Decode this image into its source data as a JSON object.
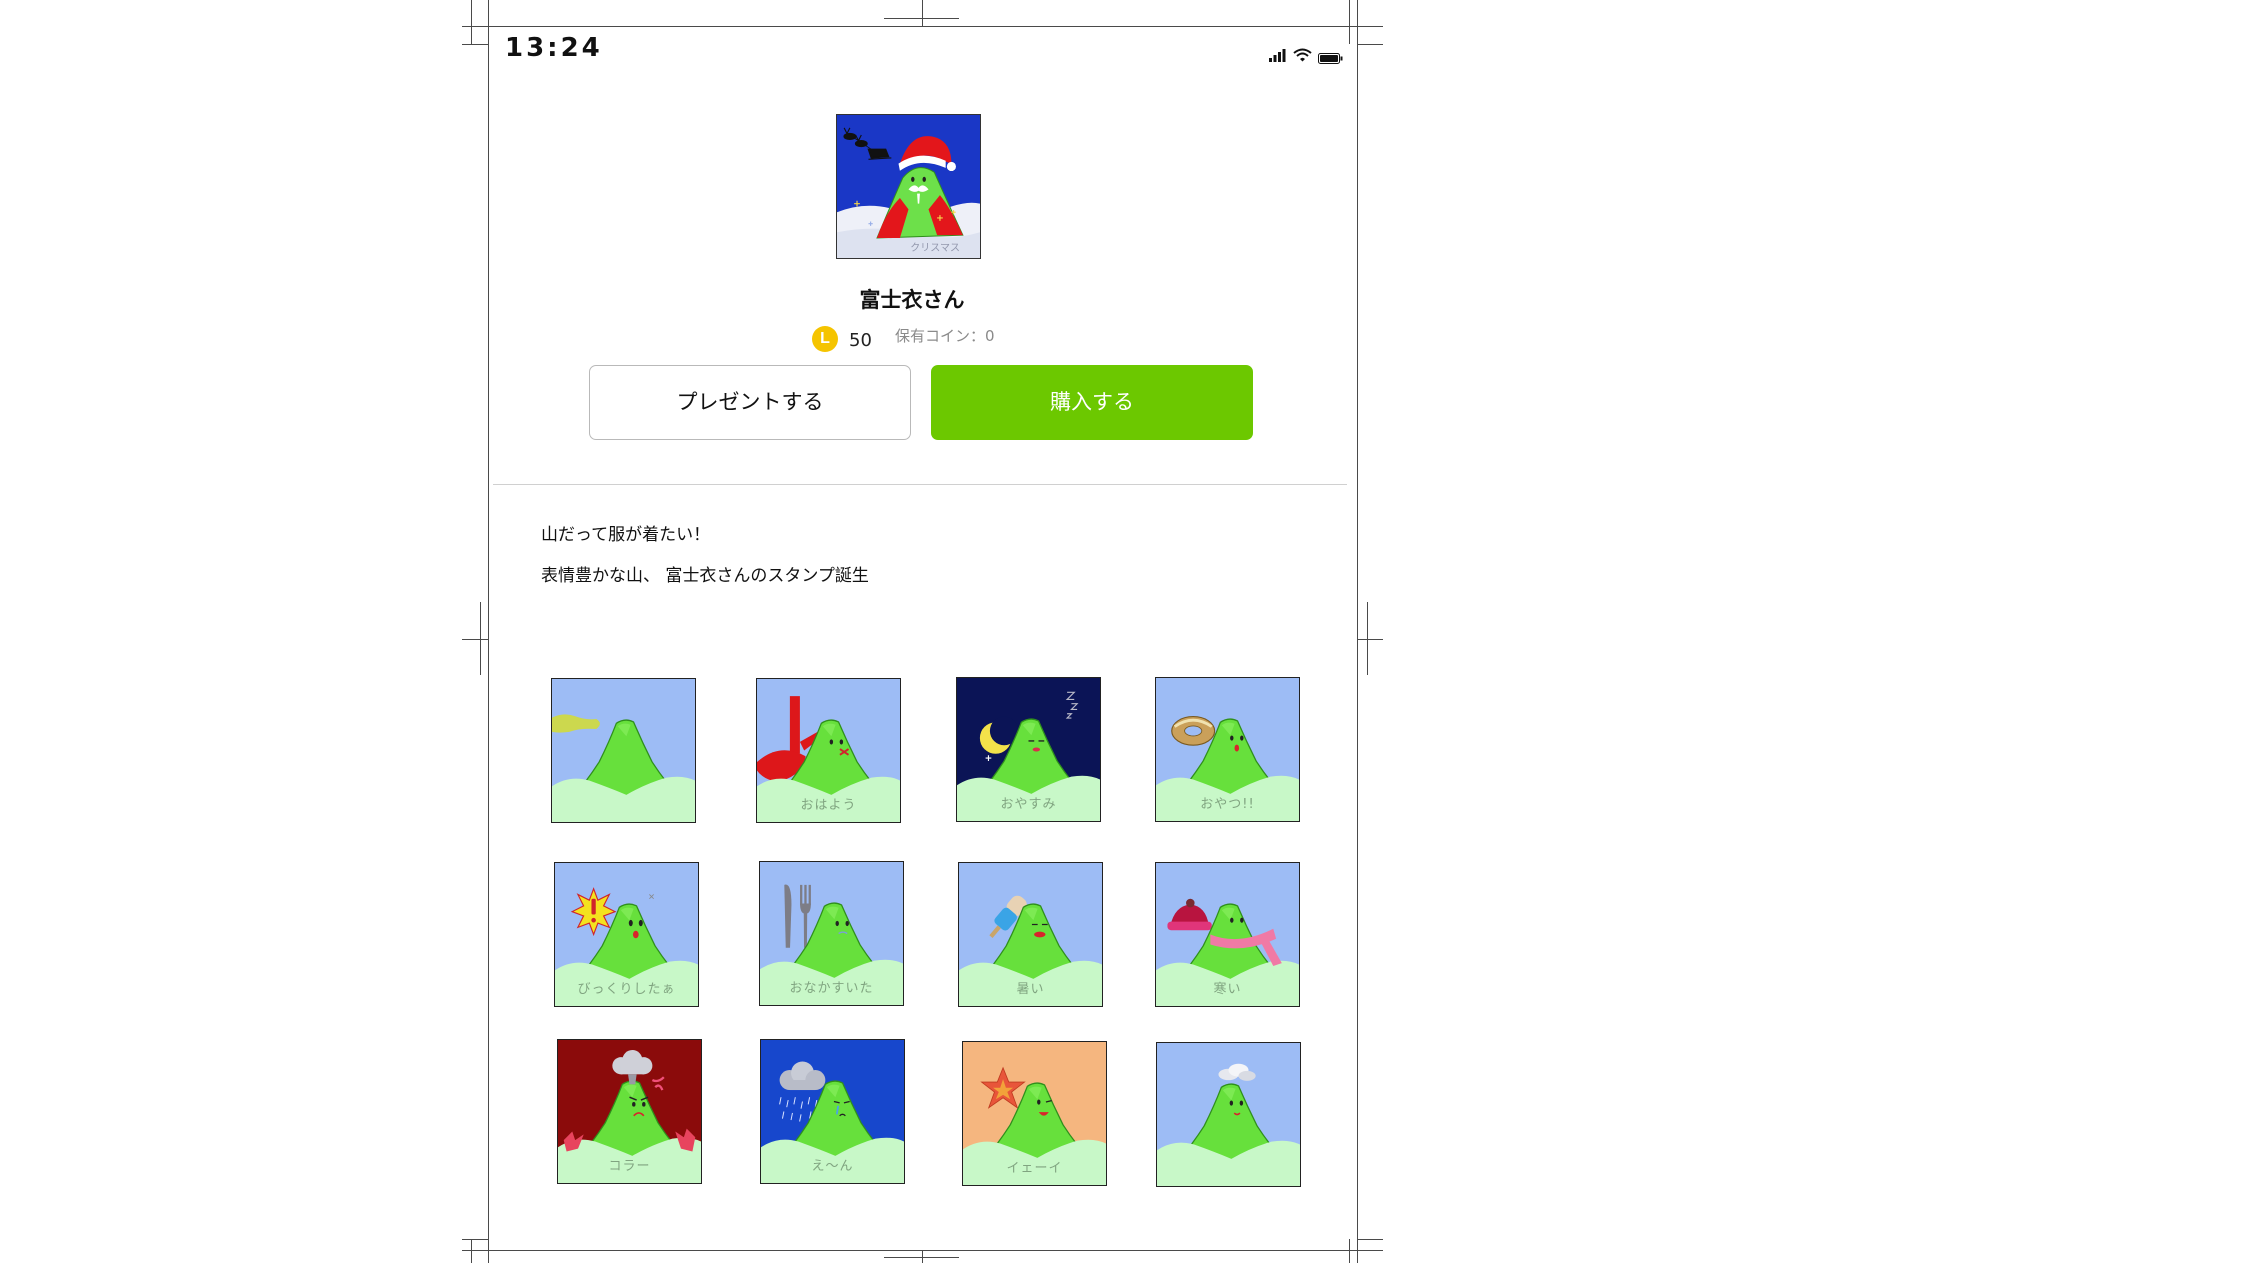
{
  "status_bar": {
    "time": "13:24",
    "icons": [
      "signal-icon",
      "wifi-icon",
      "battery-icon"
    ]
  },
  "product": {
    "image_caption": "クリスマス",
    "title": "富士衣さん",
    "coin_icon_letter": "L",
    "price": "50",
    "owned_coins": "保有コイン：0"
  },
  "actions": {
    "present_label": "プレゼントする",
    "buy_label": "購入する"
  },
  "description": {
    "line1": "山だって服が着たい！",
    "line2": "表情豊かな山、 富士衣さんのスタンプ誕生"
  },
  "stickers": [
    {
      "caption": ""
    },
    {
      "caption": "おはよう"
    },
    {
      "caption": "おやすみ"
    },
    {
      "caption": "おやつ!!"
    },
    {
      "caption": "びっくりしたぁ"
    },
    {
      "caption": "おなかすいた"
    },
    {
      "caption": "暑い"
    },
    {
      "caption": "寒い"
    },
    {
      "caption": "コラー"
    },
    {
      "caption": "え〜ん"
    },
    {
      "caption": "イェーイ"
    },
    {
      "caption": ""
    }
  ],
  "colors": {
    "accent": "#6cc800",
    "coin": "#f5c400",
    "sky": "#9dbcf5",
    "mountain": "#67e03c",
    "hills": "#c8f8c8",
    "divider": "#d0d0d0"
  }
}
